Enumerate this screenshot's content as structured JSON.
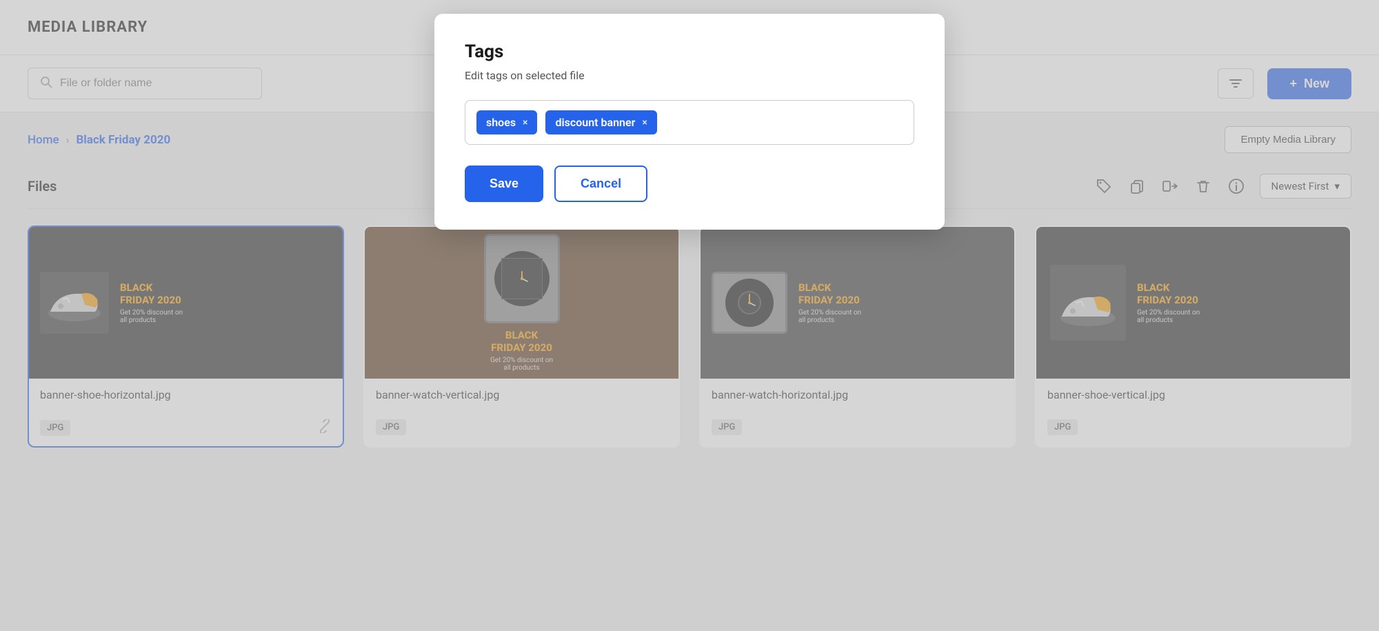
{
  "header": {
    "title": "MEDIA LIBRARY"
  },
  "toolbar": {
    "search_placeholder": "File or folder name",
    "new_button_label": "New",
    "new_button_icon": "+"
  },
  "breadcrumb": {
    "home_label": "Home",
    "current_label": "Black Friday 2020"
  },
  "empty_media_btn": "Empty Media Library",
  "files_section": {
    "title": "Files",
    "sort_label": "Newest First"
  },
  "modal": {
    "title": "Tags",
    "subtitle": "Edit tags on selected file",
    "tags": [
      {
        "label": "shoes",
        "remove": "×"
      },
      {
        "label": "discount banner",
        "remove": "×"
      }
    ],
    "save_label": "Save",
    "cancel_label": "Cancel"
  },
  "files": [
    {
      "name": "banner-shoe-horizontal.jpg",
      "type": "JPG",
      "selected": true,
      "has_link": true
    },
    {
      "name": "banner-watch-vertical.jpg",
      "type": "JPG",
      "selected": false,
      "has_link": false
    },
    {
      "name": "banner-watch-horizontal.jpg",
      "type": "JPG",
      "selected": false,
      "has_link": false
    },
    {
      "name": "banner-shoe-vertical.jpg",
      "type": "JPG",
      "selected": false,
      "has_link": false
    }
  ],
  "icons": {
    "search": "🔍",
    "filter": "⊟",
    "tag": "🏷",
    "copy": "⎘",
    "move": "→",
    "delete": "🗑",
    "info": "ⓘ",
    "link": "🔗",
    "chevron_right": "›",
    "chevron_down": "▾"
  }
}
